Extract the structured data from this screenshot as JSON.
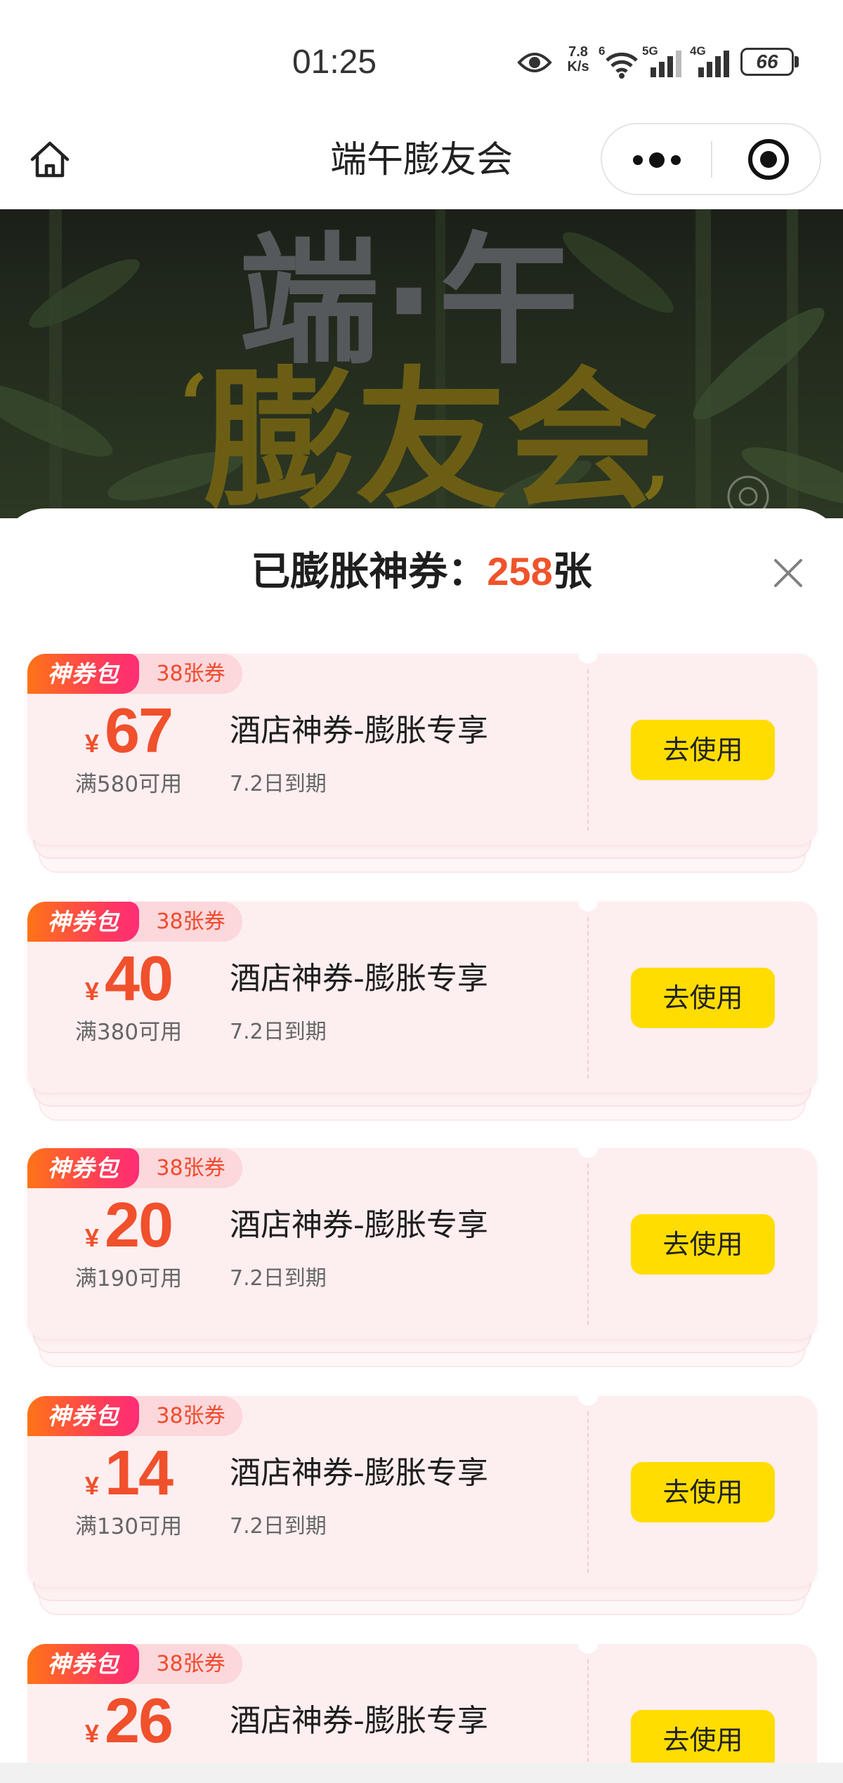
{
  "status_bar": {
    "time": "01:25",
    "speed_value": "7.8",
    "speed_unit": "K/s",
    "wifi_label": "6",
    "signal1_label": "5G",
    "signal2_label": "4G",
    "battery": "66",
    "icons": [
      "eye-icon",
      "wifi-icon",
      "signal-icon",
      "battery-icon"
    ]
  },
  "nav": {
    "title": "端午膨友会",
    "icons": [
      "home-icon",
      "more-dots-icon",
      "target-icon"
    ]
  },
  "banner": {
    "line1": "端·午",
    "line2": "膨友会",
    "quote_open": "‘",
    "quote_close": "’"
  },
  "sheet": {
    "header_label": "已膨胀神券：",
    "header_count": "258",
    "header_unit": "张",
    "close_icon": "close-icon"
  },
  "colors": {
    "accent": "#f0532b",
    "button": "#ffdd00",
    "card": "#fdeef0",
    "tag_gradient_start": "#ff7416",
    "tag_gradient_end": "#ff2d78",
    "count_tag_bg": "#fcd7db"
  },
  "coupons": [
    {
      "tag": "神券包",
      "count_tag": "38张券",
      "currency": "¥",
      "amount": "67",
      "condition": "满580可用",
      "title": "酒店神券-膨胀专享",
      "expiry": "7.2日到期",
      "button": "去使用"
    },
    {
      "tag": "神券包",
      "count_tag": "38张券",
      "currency": "¥",
      "amount": "40",
      "condition": "满380可用",
      "title": "酒店神券-膨胀专享",
      "expiry": "7.2日到期",
      "button": "去使用"
    },
    {
      "tag": "神券包",
      "count_tag": "38张券",
      "currency": "¥",
      "amount": "20",
      "condition": "满190可用",
      "title": "酒店神券-膨胀专享",
      "expiry": "7.2日到期",
      "button": "去使用"
    },
    {
      "tag": "神券包",
      "count_tag": "38张券",
      "currency": "¥",
      "amount": "14",
      "condition": "满130可用",
      "title": "酒店神券-膨胀专享",
      "expiry": "7.2日到期",
      "button": "去使用"
    },
    {
      "tag": "神券包",
      "count_tag": "38张券",
      "currency": "¥",
      "amount": "26",
      "title": "酒店神券-膨胀专享",
      "button": "去使用"
    }
  ]
}
